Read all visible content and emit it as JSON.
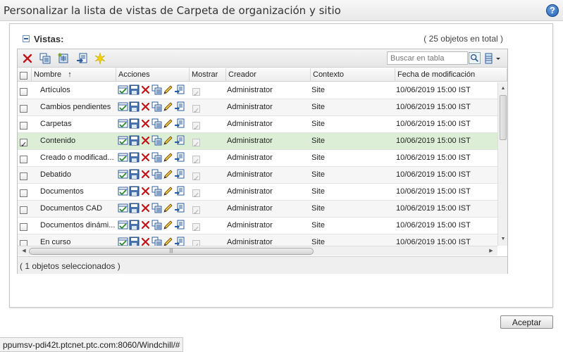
{
  "window": {
    "title": "Personalizar la lista de vistas de Carpeta de organización y sitio"
  },
  "section": {
    "title": "Vistas:",
    "count_text": "( 25 objetos en total )"
  },
  "toolbar": {
    "icons": [
      "delete-icon",
      "copy-view-icon",
      "duplicate-view-icon",
      "set-default-icon",
      "new-view-icon"
    ],
    "search_placeholder": "Buscar en tabla"
  },
  "columns": {
    "name": "Nombre",
    "sort_indicator": "↑",
    "actions": "Acciones",
    "show": "Mostrar",
    "creator": "Creador",
    "context": "Contexto",
    "date": "Fecha de modificación"
  },
  "row_actions": [
    "set-default-icon",
    "save-as-icon",
    "delete-icon",
    "copy-icon",
    "edit-pencil-icon",
    "apply-view-icon"
  ],
  "rows": [
    {
      "selected": false,
      "name": "Artículos",
      "show": true,
      "creator": "Administrator",
      "context": "Site",
      "date": "10/06/2019 15:00 IST"
    },
    {
      "selected": false,
      "name": "Cambios pendientes",
      "show": true,
      "creator": "Administrator",
      "context": "Site",
      "date": "10/06/2019 15:00 IST"
    },
    {
      "selected": false,
      "name": "Carpetas",
      "show": true,
      "creator": "Administrator",
      "context": "Site",
      "date": "10/06/2019 15:00 IST"
    },
    {
      "selected": true,
      "name": "Contenido",
      "show": true,
      "creator": "Administrator",
      "context": "Site",
      "date": "10/06/2019 15:00 IST"
    },
    {
      "selected": false,
      "name": "Creado o modificad...",
      "show": true,
      "creator": "Administrator",
      "context": "Site",
      "date": "10/06/2019 15:00 IST"
    },
    {
      "selected": false,
      "name": "Debatido",
      "show": true,
      "creator": "Administrator",
      "context": "Site",
      "date": "10/06/2019 15:00 IST"
    },
    {
      "selected": false,
      "name": "Documentos",
      "show": true,
      "creator": "Administrator",
      "context": "Site",
      "date": "10/06/2019 15:00 IST"
    },
    {
      "selected": false,
      "name": "Documentos CAD",
      "show": true,
      "creator": "Administrator",
      "context": "Site",
      "date": "10/06/2019 15:00 IST"
    },
    {
      "selected": false,
      "name": "Documentos dinámi...",
      "show": true,
      "creator": "Administrator",
      "context": "Site",
      "date": "10/06/2019 15:00 IST"
    },
    {
      "selected": false,
      "name": "En curso",
      "show": true,
      "creator": "Administrator",
      "context": "Site",
      "date": "10/06/2019 15:00 IST"
    }
  ],
  "status": {
    "selected_text": "( 1 objetos seleccionados )"
  },
  "buttons": {
    "ok_label": "Aceptar"
  },
  "statusbar": {
    "url": "ppumsv-pdi42t.ptcnet.ptc.com:8060/Windchill/#"
  },
  "colors": {
    "selected_row": "#dcefd6",
    "delete_red": "#c0141a",
    "icon_blue": "#2e5e9c"
  }
}
